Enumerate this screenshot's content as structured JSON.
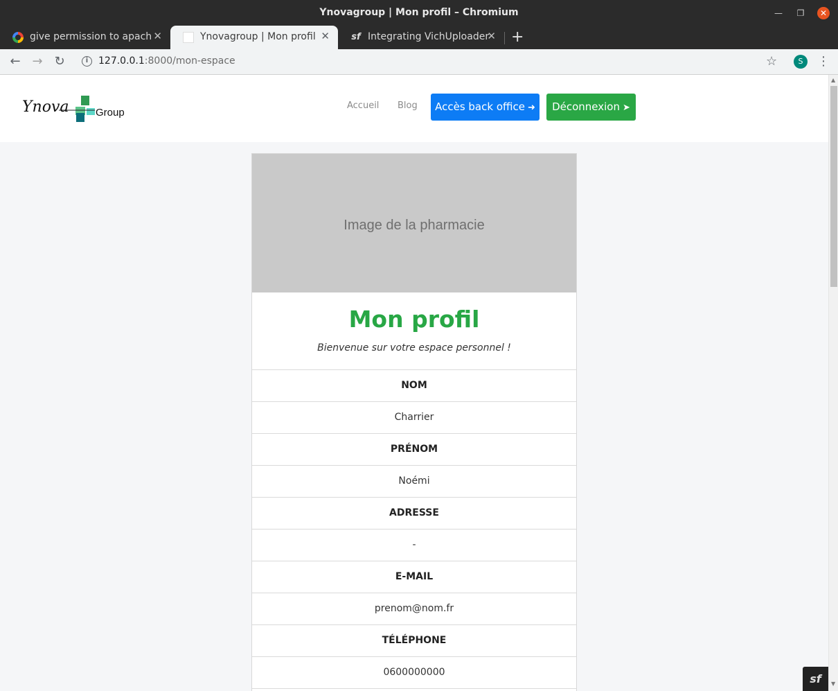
{
  "window": {
    "title": "Ynovagroup | Mon profil – Chromium"
  },
  "tabs": [
    {
      "label": "give permission to apache",
      "icon": "google-icon",
      "active": false
    },
    {
      "label": "Ynovagroup | Mon profil",
      "icon": "ynova-favicon",
      "active": true
    },
    {
      "label": "Integrating VichUploader",
      "icon": "symfony-icon",
      "active": false
    }
  ],
  "address_bar": {
    "url_host": "127.0.0.1",
    "url_rest": ":8000/mon-espace",
    "avatar_letter": "S"
  },
  "header": {
    "logo_text": "Ynova",
    "logo_group": "Group",
    "nav": {
      "home": "Accueil",
      "blog": "Blog"
    },
    "backoffice_button": "Accès back office",
    "logout_button": "Déconnexion"
  },
  "profile": {
    "image_placeholder": "Image de la pharmacie",
    "title": "Mon profil",
    "subtitle": "Bienvenue sur votre espace personnel !",
    "fields": [
      {
        "label": "NOM",
        "value": "Charrier"
      },
      {
        "label": "PRÉNOM",
        "value": "Noémi"
      },
      {
        "label": "ADRESSE",
        "value": "-"
      },
      {
        "label": "E-MAIL",
        "value": "prenom@nom.fr"
      },
      {
        "label": "TÉLÉPHONE",
        "value": "0600000000"
      }
    ]
  },
  "colors": {
    "primary_button": "#0d7cf5",
    "success_button": "#2aa745",
    "title_green": "#28a745"
  }
}
